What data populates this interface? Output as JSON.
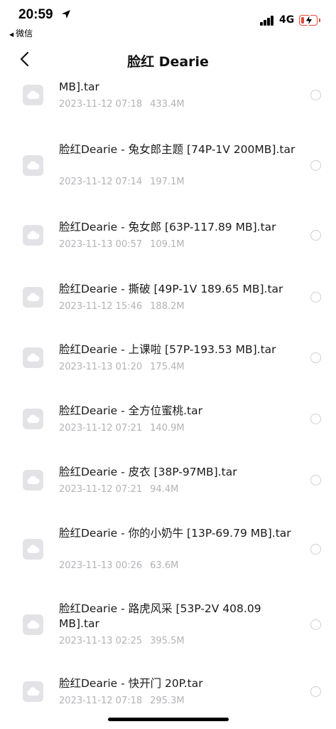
{
  "status_bar": {
    "time": "20:59",
    "back_app": "微信",
    "network": "4G",
    "battery_percent": 20,
    "battery_color": "#e24a3c"
  },
  "nav": {
    "title": "脸红 Dearie"
  },
  "files": [
    {
      "name": "MB].tar",
      "date": "2023-11-12 07:18",
      "size": "433.4M"
    },
    {
      "name": "脸红Dearie - 兔女郎主题 [74P-1V 200MB].tar",
      "date": "2023-11-12 07:14",
      "size": "197.1M"
    },
    {
      "name": "脸红Dearie - 兔女郎 [63P-117.89 MB].tar",
      "date": "2023-11-13 00:57",
      "size": "109.1M"
    },
    {
      "name": "脸红Dearie - 撕破 [49P-1V 189.65 MB].tar",
      "date": "2023-11-12 15:46",
      "size": "188.2M"
    },
    {
      "name": "脸红Dearie - 上课啦 [57P-193.53 MB].tar",
      "date": "2023-11-13 01:20",
      "size": "175.4M"
    },
    {
      "name": "脸红Dearie - 全方位蜜桃.tar",
      "date": "2023-11-12 07:21",
      "size": "140.9M"
    },
    {
      "name": "脸红Dearie - 皮衣 [38P-97MB].tar",
      "date": "2023-11-12 07:21",
      "size": "94.4M"
    },
    {
      "name": "脸红Dearie - 你的小奶牛 [13P-69.79 MB].tar",
      "date": "2023-11-13 00:26",
      "size": "63.6M"
    },
    {
      "name": "脸红Dearie - 路虎风采 [53P-2V 408.09 MB].tar",
      "date": "2023-11-13 02:25",
      "size": "395.5M"
    },
    {
      "name": "脸红Dearie - 快开门 20P.tar",
      "date": "2023-11-12 07:18",
      "size": "295.3M"
    }
  ],
  "icons": {
    "location": "location-arrow-icon",
    "signal": "cellular-signal-icon",
    "battery": "battery-charging-icon",
    "back": "chevron-left-icon",
    "file": "cloud-file-icon",
    "select": "radio-circle-icon"
  }
}
